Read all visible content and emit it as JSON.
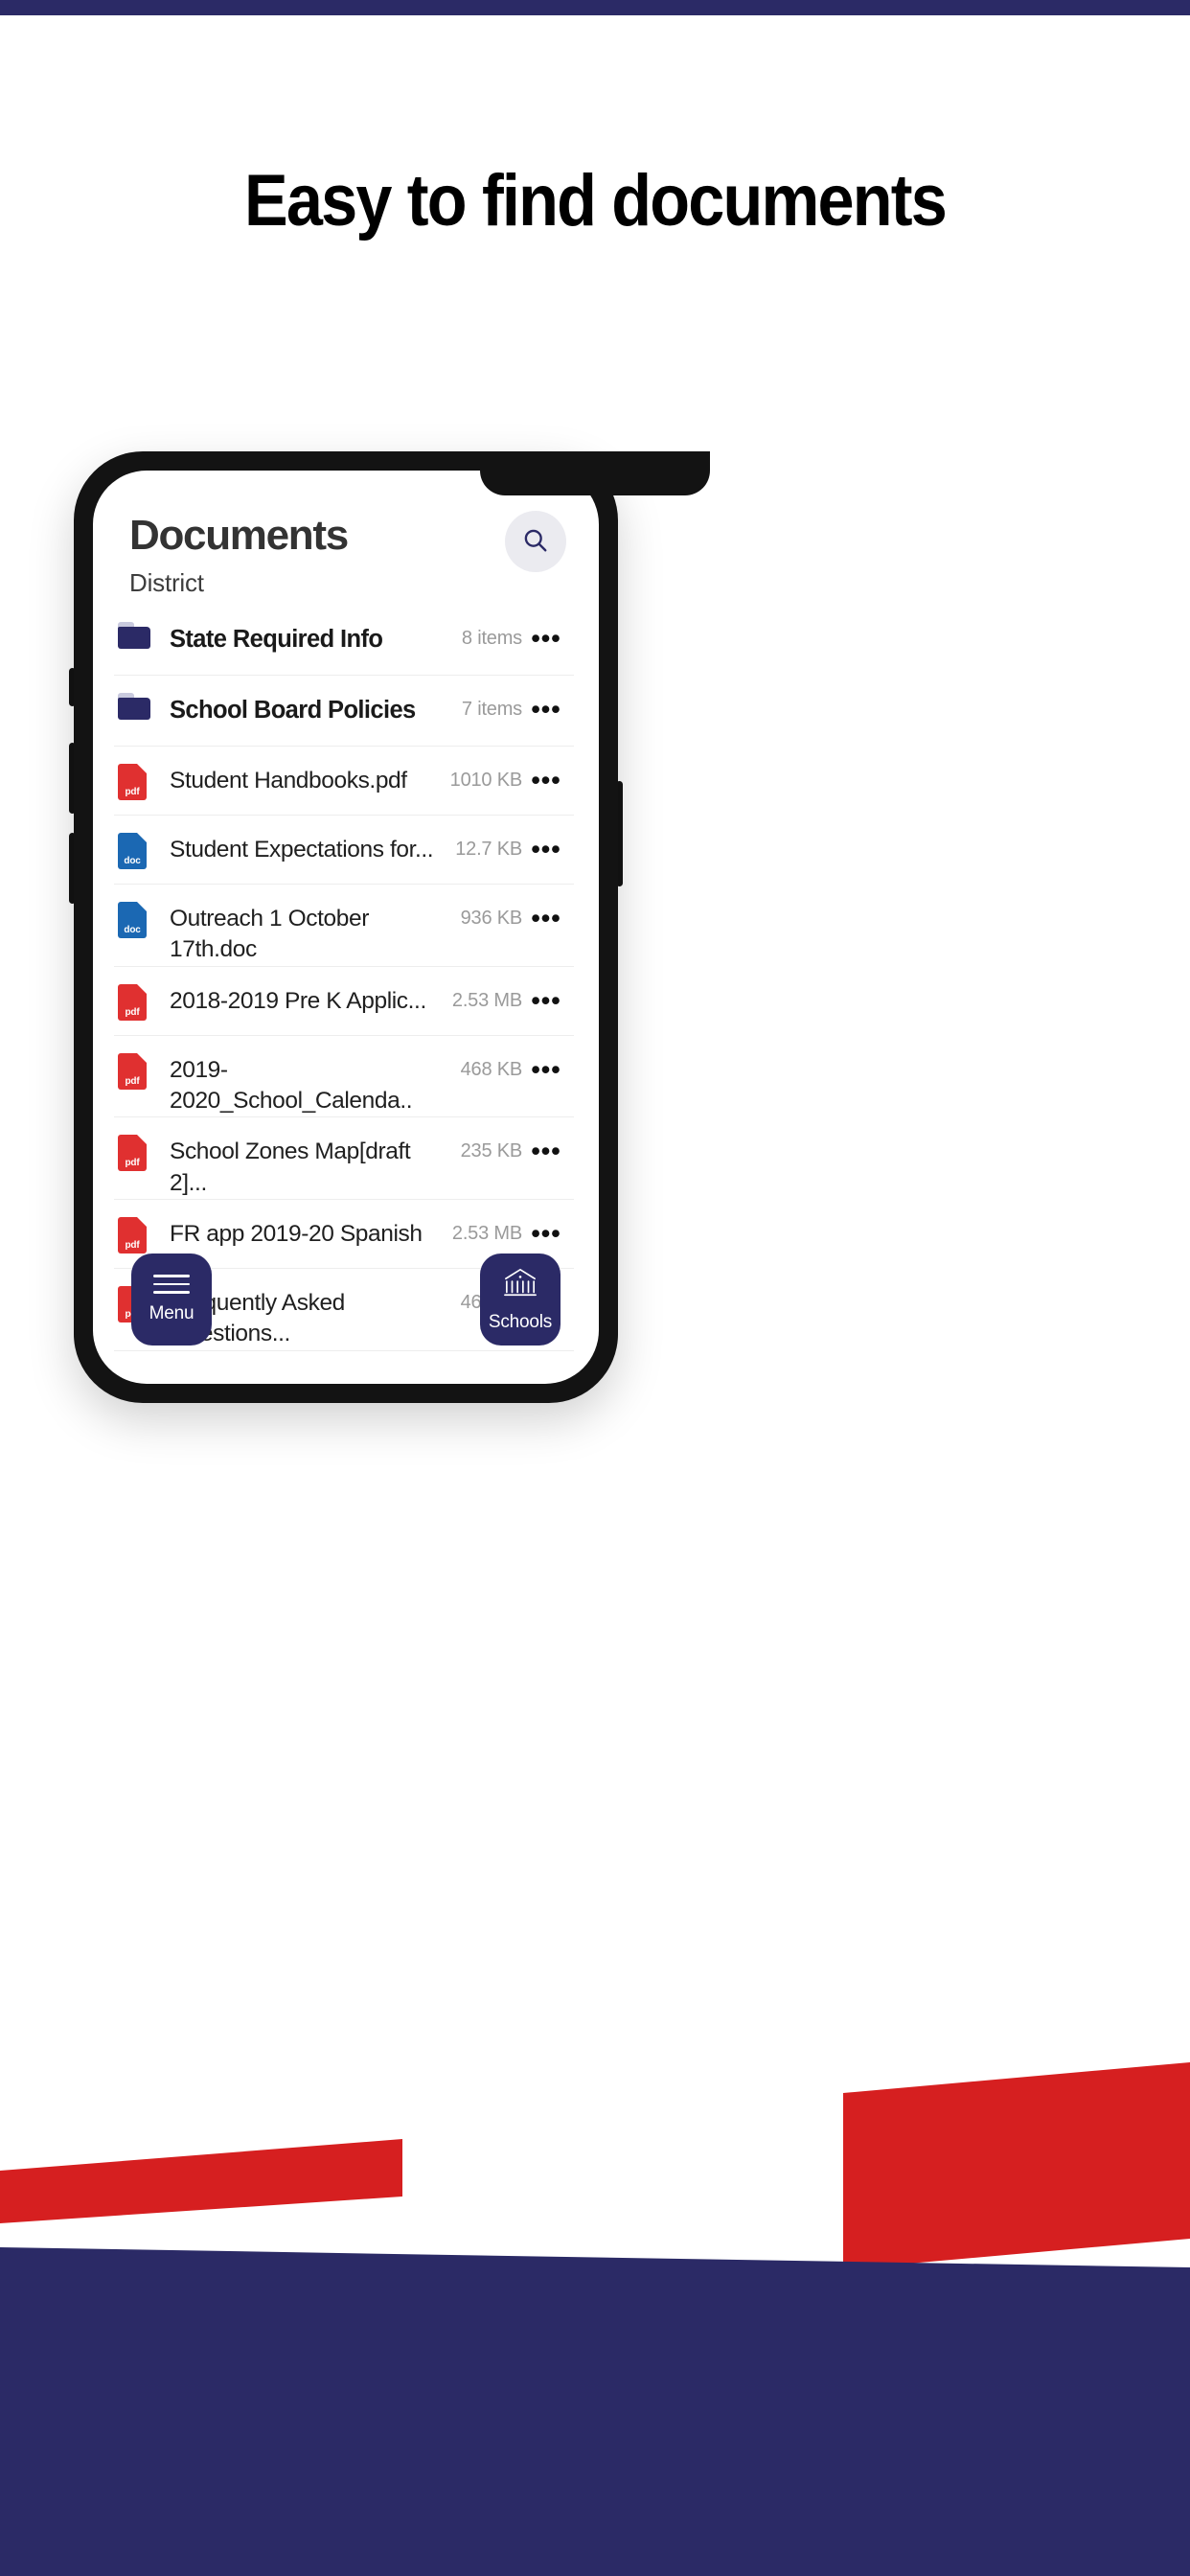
{
  "page": {
    "headline": "Easy to find documents",
    "top_bar_color": "#2b2a66",
    "accent_navy": "#2b2a66",
    "accent_red": "#d61f20",
    "background": "#ffffff"
  },
  "app": {
    "title": "Documents",
    "subtitle": "District",
    "search_icon": "search-icon"
  },
  "files": [
    {
      "type": "folder",
      "icon": "folder-icon",
      "name": "State Required Info",
      "meta": "8 items",
      "ext": ""
    },
    {
      "type": "folder",
      "icon": "folder-icon",
      "name": "School Board Policies",
      "meta": "7 items",
      "ext": ""
    },
    {
      "type": "file",
      "icon": "pdf-file-icon",
      "name": "Student Handbooks.pdf",
      "meta": "1010 KB",
      "ext": "pdf"
    },
    {
      "type": "file",
      "icon": "doc-file-icon",
      "name": "Student Expectations for...",
      "meta": "12.7 KB",
      "ext": "doc"
    },
    {
      "type": "file",
      "icon": "doc-file-icon",
      "name": "Outreach 1 October 17th.doc",
      "meta": "936 KB",
      "ext": "doc"
    },
    {
      "type": "file",
      "icon": "pdf-file-icon",
      "name": "2018-2019 Pre K Applic...",
      "meta": "2.53 MB",
      "ext": "pdf"
    },
    {
      "type": "file",
      "icon": "pdf-file-icon",
      "name": "2019-2020_School_Calenda..",
      "meta": "468 KB",
      "ext": "pdf"
    },
    {
      "type": "file",
      "icon": "pdf-file-icon",
      "name": "School Zones Map[draft 2]...",
      "meta": "235 KB",
      "ext": "pdf"
    },
    {
      "type": "file",
      "icon": "pdf-file-icon",
      "name": "FR app 2019-20 Spanish",
      "meta": "2.53 MB",
      "ext": "pdf"
    },
    {
      "type": "file",
      "icon": "pdf-file-icon",
      "name": "Frequently Asked Questions...",
      "meta": "468 KB",
      "ext": "pdf"
    }
  ],
  "row_more_glyph": "•••",
  "bottom_nav": {
    "menu": {
      "label": "Menu",
      "icon": "hamburger-menu-icon"
    },
    "schools": {
      "label": "Schools",
      "icon": "school-building-icon"
    }
  }
}
